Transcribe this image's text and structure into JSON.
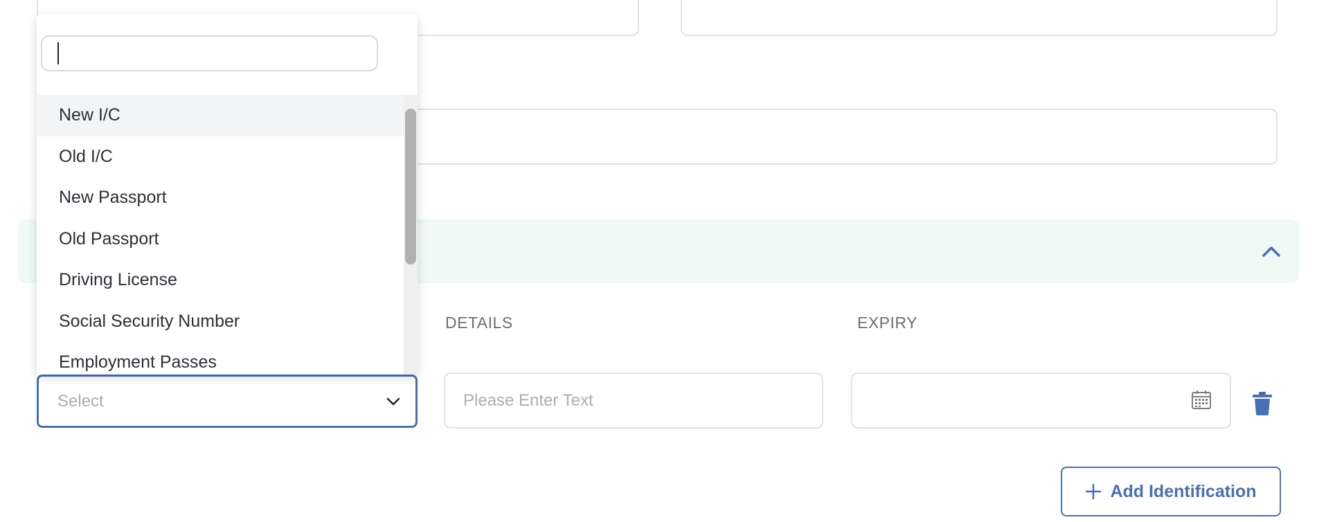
{
  "form": {
    "section_expanded": true
  },
  "identification": {
    "headers": {
      "details": "DETAILS",
      "expiry": "EXPIRY"
    },
    "type_select": {
      "placeholder": "Select"
    },
    "details_input": {
      "value": "",
      "placeholder": "Please Enter Text"
    },
    "expiry_input": {
      "value": ""
    },
    "add_button_label": "Add Identification"
  },
  "dropdown": {
    "search_value": "",
    "options": [
      "New I/C",
      "Old I/C",
      "New Passport",
      "Old Passport",
      "Driving License",
      "Social Security Number",
      "Employment Passes"
    ],
    "highlighted_index": 0
  },
  "colors": {
    "accent": "#4a6fb5",
    "section_bg": "#eef8f5",
    "border": "#dfe2e7"
  }
}
